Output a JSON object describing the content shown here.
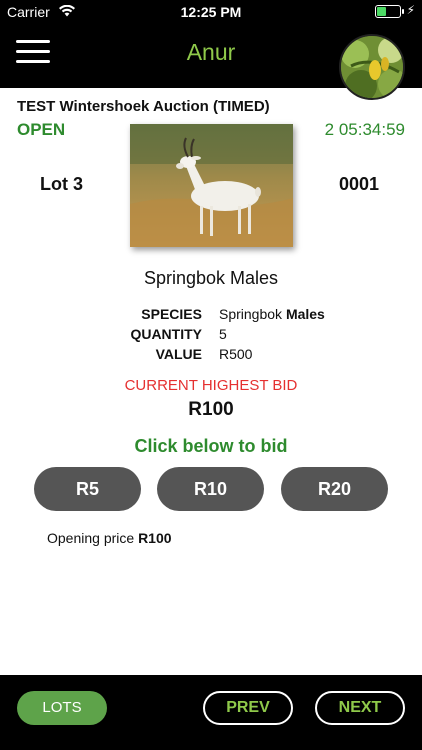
{
  "status_bar": {
    "carrier": "Carrier",
    "time": "12:25 PM",
    "battery_level": 0.45
  },
  "nav": {
    "title": "Anur",
    "menu_icon": "hamburger-icon",
    "avatar": "profile-avatar"
  },
  "auction": {
    "title": "TEST Wintershoek Auction (TIMED)",
    "status": "OPEN",
    "countdown": "2 05:34:59"
  },
  "lot": {
    "number": "Lot 3",
    "code": "0001",
    "name": "Springbok Males",
    "species_label": "SPECIES",
    "species_value": "Springbok",
    "species_value_bold": "Males",
    "quantity_label": "QUANTITY",
    "quantity_value": "5",
    "value_label": "VALUE",
    "value_value": "R500"
  },
  "bidding": {
    "current_label": "CURRENT HIGHEST BID",
    "current_amount": "R100",
    "cta": "Click below to bid",
    "increments": [
      "R5",
      "R10",
      "R20"
    ],
    "opening_label": "Opening price",
    "opening_value": "R100"
  },
  "footer": {
    "lots": "LOTS",
    "prev": "PREV",
    "next": "NEXT"
  },
  "colors": {
    "accent_green": "#2e8b2e",
    "nav_green": "#8fc94a",
    "bid_red": "#e53030"
  }
}
